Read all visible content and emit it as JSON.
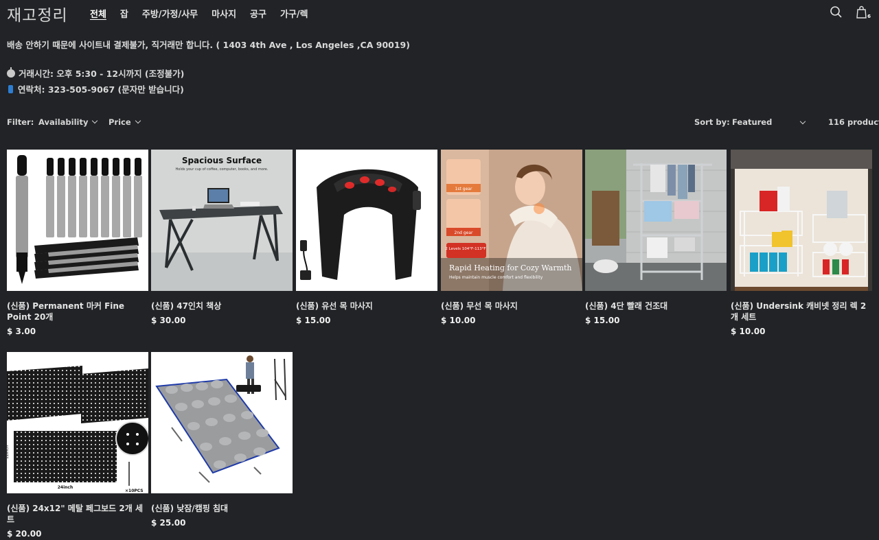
{
  "header": {
    "logo": "재고정리",
    "nav": [
      "전체",
      "잡",
      "주방/가정/사무",
      "마사지",
      "공구",
      "가구/렉"
    ],
    "cart_count": "6"
  },
  "notice": {
    "line1": "배송 안하기 때문에 사이트내 결제불가, 직거래만 합니다. ( 1403 4th Ave , Los Angeles ,CA 90019)",
    "line2": "거래시간: 오후 5:30 - 12시까지 (조정불가)",
    "line3": "연락처: 323-505-9067 (문자만 받습니다)"
  },
  "filters": {
    "filter_label": "Filter:",
    "availability": "Availability",
    "price": "Price",
    "sort_label": "Sort by:",
    "sort_value": "Featured",
    "count": "116 products"
  },
  "products": [
    {
      "title": "(신품) Permanent 마커 Fine Point 20개",
      "price": "$ 3.00",
      "image_caption": "Marker"
    },
    {
      "title": "(신품) 47인치 책상",
      "price": "$ 30.00",
      "image_caption": "Spacious Surface",
      "image_subcaption": "Holds your cup of coffee, computer, books, and more."
    },
    {
      "title": "(신품) 유선 목 마사지",
      "price": "$ 15.00"
    },
    {
      "title": "(신품) 무선 목 마사지",
      "price": "$ 10.00",
      "image_caption": "Rapid Heating for Cozy Warmth",
      "image_subcaption": "Helps maintain muscle comfort and flexibility",
      "badge1": "1st gear",
      "badge2": "2nd gear",
      "badge3": "2 Levels 104°F-113°F"
    },
    {
      "title": "(신품) 4단 빨래 건조대",
      "price": "$ 15.00"
    },
    {
      "title": "(신품) Undersink 캐비넷 정리 렉 2개 세트",
      "price": "$ 10.00"
    },
    {
      "title": "(신품) 24x12\" 메탈 페그보드 2개 세트",
      "price": "$ 20.00",
      "dim1": "12inch",
      "dim2": "24inch",
      "dim3": "×10PCS"
    },
    {
      "title": "(신품) 낮잠/캠핑 침대",
      "price": "$ 25.00"
    }
  ],
  "colors": {
    "background": "#212326",
    "text": "#e6e6e6"
  }
}
